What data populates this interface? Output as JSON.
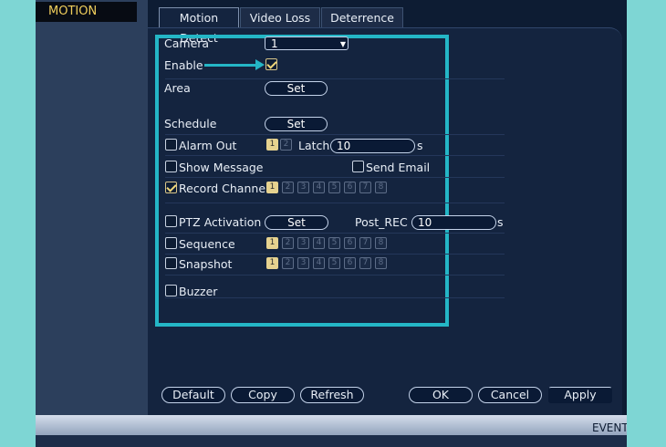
{
  "sidebar": {
    "title": "MOTION"
  },
  "tabs": [
    {
      "label": "Motion Detect",
      "active": true
    },
    {
      "label": "Video Loss",
      "active": false
    },
    {
      "label": "Deterrence",
      "active": false
    }
  ],
  "form": {
    "camera_label": "Camera",
    "camera_value": "1",
    "enable_label": "Enable",
    "enable_checked": true,
    "area_label": "Area",
    "area_button": "Set",
    "schedule_label": "Schedule",
    "schedule_button": "Set",
    "alarm_out_label": "Alarm Out",
    "alarm_out_channels": [
      "1",
      "2"
    ],
    "latch_label": "Latch",
    "latch_value": "10",
    "latch_unit": "s",
    "show_message_label": "Show Message",
    "send_email_label": "Send Email",
    "record_channel_label": "Record Channel",
    "record_channel_checked": true,
    "channels": [
      "1",
      "2",
      "3",
      "4",
      "5",
      "6",
      "7",
      "8"
    ],
    "ptz_label": "PTZ Activation",
    "ptz_button": "Set",
    "post_rec_label": "Post_REC",
    "post_rec_value": "10",
    "post_rec_unit": "s",
    "sequence_label": "Sequence",
    "snapshot_label": "Snapshot",
    "buzzer_label": "Buzzer"
  },
  "buttons": {
    "default": "Default",
    "copy": "Copy",
    "refresh": "Refresh",
    "ok": "OK",
    "cancel": "Cancel",
    "apply": "Apply"
  },
  "bottom_bar": {
    "label": "EVENT"
  },
  "colors": {
    "highlight": "#24b6c6",
    "accent_yellow": "#f0ce5c",
    "panel": "#14243f"
  }
}
